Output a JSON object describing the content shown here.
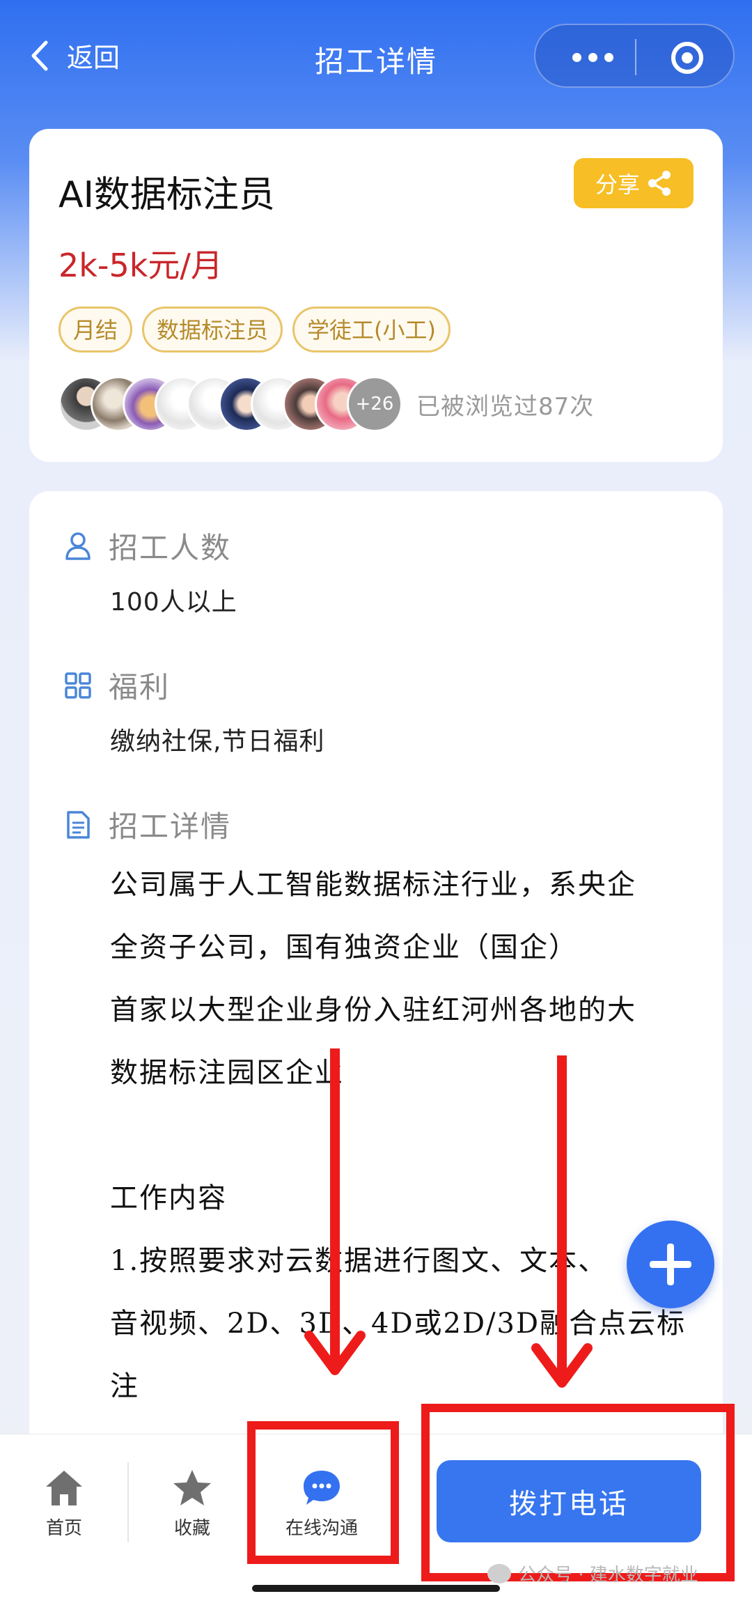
{
  "nav": {
    "back_label": "返回",
    "title": "招工详情"
  },
  "job": {
    "title": "AI数据标注员",
    "salary": "2k-5k元/月",
    "share_label": "分享",
    "tags": [
      "月结",
      "数据标注员",
      "学徒工(小工)"
    ],
    "avatar_more": "+26",
    "views": "已被浏览过87次"
  },
  "sections": {
    "headcount": {
      "label": "招工人数",
      "value": "100人以上"
    },
    "welfare": {
      "label": "福利",
      "value": "缴纳社保,节日福利"
    },
    "details": {
      "label": "招工详情",
      "lines": [
        "公司属于人工智能数据标注行业，系央企",
        "全资子公司，国有独资企业（国企）",
        "首家以大型企业身份入驻红河州各地的大",
        "数据标注园区企业",
        "",
        "工作内容",
        "1.按照要求对云数据进行图文、文本、",
        "音视频、2D、3D、4D或2D/3D融合点云标",
        "注"
      ]
    }
  },
  "bottom_bar": {
    "home_label": "首页",
    "favorite_label": "收藏",
    "chat_label": "在线沟通",
    "call_label": "拨打电话"
  },
  "watermark": "公众号 · 建水数字就业",
  "colors": {
    "primary": "#3471f0",
    "salary": "#c9262a",
    "share": "#f7be25",
    "annotation": "#ee1b1b"
  },
  "icons": {
    "back": "chevron-left-icon",
    "more": "more-dots-icon",
    "close": "target-circle-icon",
    "share": "share-icon",
    "headcount": "person-icon",
    "welfare": "grid-icon",
    "details": "document-icon",
    "home": "home-icon",
    "favorite": "star-icon",
    "chat": "chat-bubble-icon",
    "fab": "plus-icon"
  }
}
